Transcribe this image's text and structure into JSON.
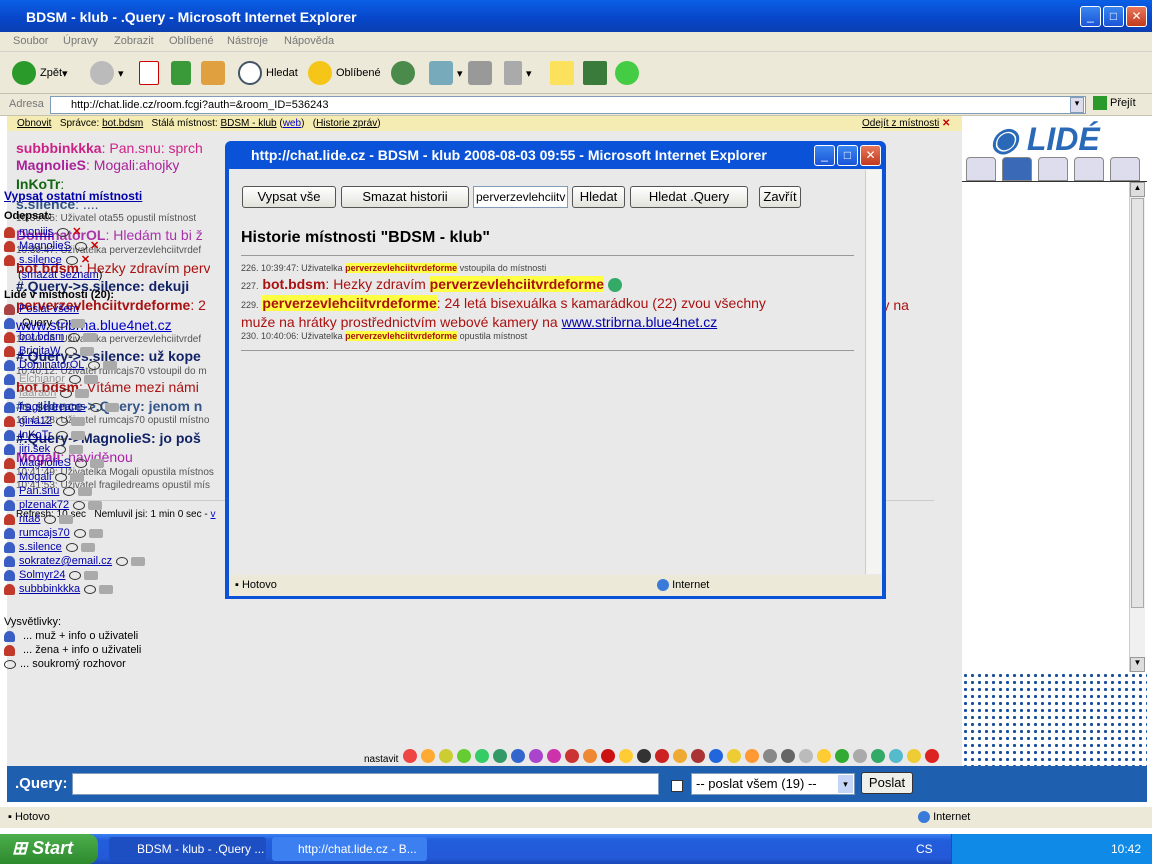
{
  "window": {
    "title": "BDSM - klub - .Query - Microsoft Internet Explorer"
  },
  "menu": [
    "Soubor",
    "Úpravy",
    "Zobrazit",
    "Oblíbené",
    "Nástroje",
    "Nápověda"
  ],
  "toolbar": {
    "back": "Zpět",
    "search": "Hledat",
    "favorites": "Oblíbené"
  },
  "address": {
    "label": "Adresa",
    "url": "http://chat.lide.cz/room.fcgi?auth=&room_ID=536243",
    "go": "Přejít"
  },
  "infobar": {
    "refresh": "Obnovit",
    "admin_label": "Správce:",
    "admin": "bot.bdsm",
    "room_label": "Stálá místnost:",
    "room": "BDSM - klub",
    "web": "web",
    "history": "Historie zpráv",
    "leave": "Odejít z místnosti"
  },
  "chat": [
    {
      "nick": "subbbinkkka",
      "text": ": Pan.snu: sprch",
      "color": "#cc2288"
    },
    {
      "nick": "MagnolieS",
      "text": ": Mogali:ahojky",
      "color": "#aa2299"
    },
    {
      "nick": "InKoTr",
      "text": ":",
      "color": "#116611"
    },
    {
      "nick": "s.silence",
      "text": ": ....",
      "color": "#335588"
    },
    {
      "sys": "10:39:05: Uživatel ota55 opustil místnost"
    },
    {
      "nick": "DominatorOL",
      "text": ": Hledám tu bi ž",
      "color": "#aa33aa"
    },
    {
      "sys": "10:39:47: Uživatelka perverzevlehciitvrdef"
    },
    {
      "nick": "bot.bdsm",
      "text": ": Hezky zdravím perv",
      "color": "#aa1111"
    },
    {
      "nick": "#.Query->s.silence: dekuji",
      "text": "",
      "color": "#112266"
    },
    {
      "nick": "perverzevlehciitvrdeforme",
      "text": ": 2",
      "color": "#aa1111"
    },
    {
      "link": "www.stribrna.blue4net.cz"
    },
    {
      "sys": "10:40:06: Uživatelka perverzevlehciitvrdef"
    },
    {
      "nick": "#.Query->s.silence: už kope",
      "text": "",
      "color": "#112266"
    },
    {
      "sys": "10:40:12: Uživatel rumcajs70 vstoupil do m"
    },
    {
      "nick": "bot.bdsm",
      "text": ": Vítáme mezi námi",
      "color": "#aa1111"
    },
    {
      "nick": "#s.silence->.Query: jenom n",
      "text": "",
      "color": "#335588"
    },
    {
      "sys": "10:41:28: Uživatel rumcajs70 opustil místno"
    },
    {
      "nick": "#.Query->MagnolieS: jo poš",
      "text": "",
      "color": "#112266"
    },
    {
      "nick": "Mogali",
      "text": ": naviděnou",
      "color": "#aa22aa"
    },
    {
      "sys": "10:41:49: Uživatelka Mogali opustila místnos"
    },
    {
      "sys": "10:41:53: Uživatel fragiledreams opustil mís"
    }
  ],
  "chat_overflow": "ery na",
  "refresh_line": "Refresh: 10 sec   Nemluvil jsi: 1 min 0 sec - ",
  "smiley_label": "nastavit",
  "input": {
    "nick": ".Query:",
    "value": "",
    "select": "-- poslat všem (19) --",
    "send": "Poslat"
  },
  "status": {
    "left": "Hotovo",
    "zone": "Internet"
  },
  "taskbar": {
    "start": "Start",
    "tasks": [
      "BDSM - klub - .Query ...",
      "http://chat.lide.cz - B..."
    ],
    "lang": "CS",
    "clock": "10:42"
  },
  "popup": {
    "title": "http://chat.lide.cz - BDSM - klub 2008-08-03 09:55 - Microsoft Internet Explorer",
    "buttons": [
      "Vypsat vše",
      "Smazat historii",
      "Hledat",
      "Hledat .Query",
      "Zavřít"
    ],
    "search_value": "perverzevlehciitv",
    "heading": "Historie místnosti \"BDSM - klub\"",
    "lines": [
      {
        "num": "226.",
        "pre": "10:39:47: Uživatelka ",
        "hl": "perverzevlehciitvrdeforme",
        "post": " vstoupila do místnosti",
        "small": true
      },
      {
        "num": "227.",
        "nick": "bot.bdsm",
        "pre": ": Hezky zdravím ",
        "hl": "perverzevlehciitvrdeforme",
        "post": ""
      },
      {
        "num": "229.",
        "hl": "perverzevlehciitvrdeforme",
        "post": ": 24 letá bisexuálka s kamarádkou (22) zvou všechny"
      },
      {
        "cont": "muže na hrátky prostřednictvím webové kamery na ",
        "link": "www.stribrna.blue4net.cz"
      },
      {
        "num": "230.",
        "pre": "10:40:06: Uživatelka ",
        "hl": "perverzevlehciitvrdeforme",
        "post": " opustila místnost",
        "small": true
      }
    ],
    "status": "Hotovo",
    "zone": "Internet"
  },
  "side": {
    "other_rooms": "Vypsat ostatní místnosti",
    "away_label": "Odepsat:",
    "away": [
      "moniiis",
      "MagnolieS",
      "s.silence"
    ],
    "clear": "smazat seznam",
    "people_label": "Lidé v místnosti (20):",
    "send_all": "Poslat všem",
    "users": [
      {
        "n": ".Query",
        "g": "male"
      },
      {
        "n": "bot.bdsm",
        "g": "female"
      },
      {
        "n": "BrigitaW",
        "g": "female"
      },
      {
        "n": "DominatorOL",
        "g": "male"
      },
      {
        "n": "Elchianor",
        "g": "male"
      },
      {
        "n": "faaraon",
        "g": "male"
      },
      {
        "n": "fragiledreams",
        "g": "male"
      },
      {
        "n": "gina12",
        "g": "female"
      },
      {
        "n": "InKoTr",
        "g": "male"
      },
      {
        "n": "jiri.sek",
        "g": "male"
      },
      {
        "n": "MagnolieS",
        "g": "female"
      },
      {
        "n": "Mogali",
        "g": "female"
      },
      {
        "n": "Pan.snu",
        "g": "male"
      },
      {
        "n": "plzenak72",
        "g": "male"
      },
      {
        "n": "rita8",
        "g": "female"
      },
      {
        "n": "rumcajs70",
        "g": "male"
      },
      {
        "n": "s.silence",
        "g": "male"
      },
      {
        "n": "sokratez@email.cz",
        "g": "male"
      },
      {
        "n": "Solmyr24",
        "g": "male"
      },
      {
        "n": "subbbinkkka",
        "g": "female"
      }
    ],
    "legend_label": "Vysvětlivky:",
    "legend": [
      "... muž + info o uživateli",
      "... žena + info o uživateli",
      "... soukromý rozhovor"
    ]
  }
}
